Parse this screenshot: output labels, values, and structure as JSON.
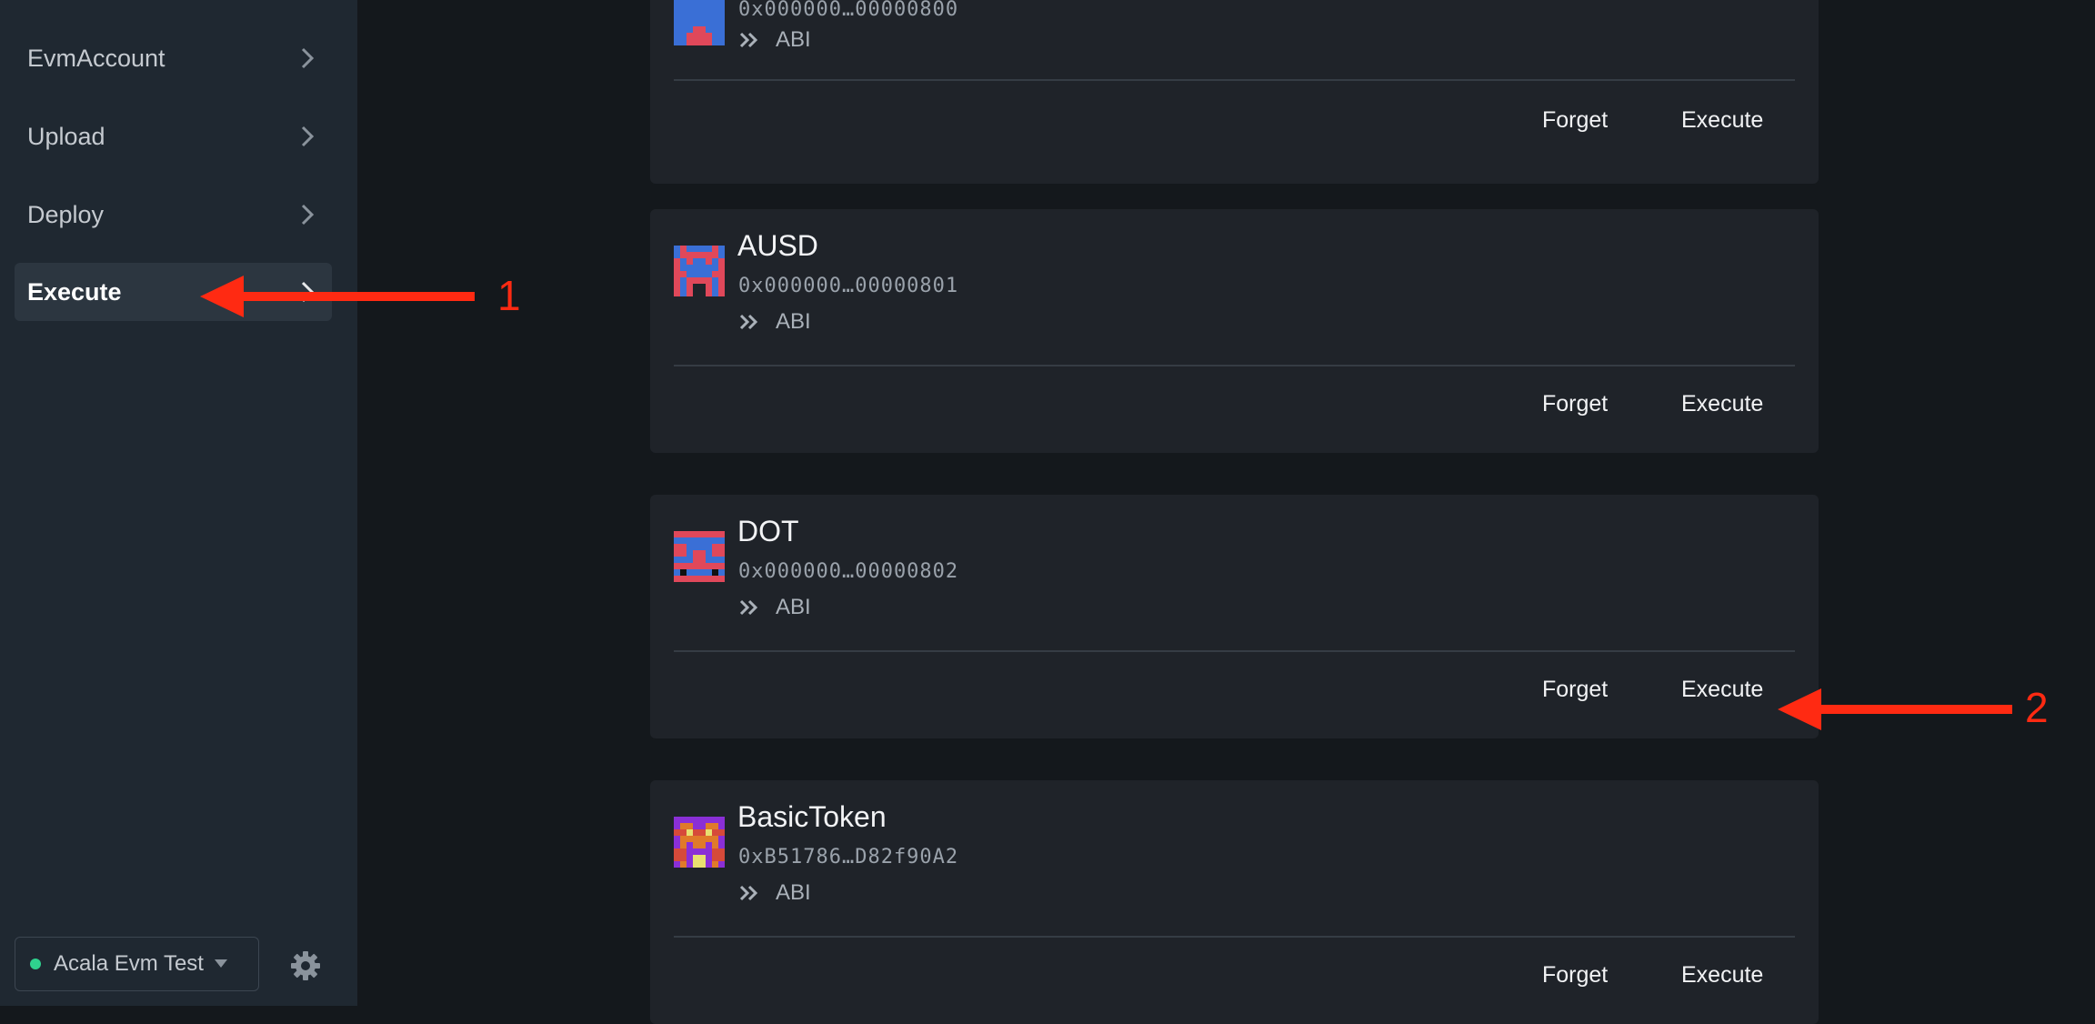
{
  "sidebar": {
    "items": [
      {
        "label": "EvmAccount",
        "active": false
      },
      {
        "label": "Upload",
        "active": false
      },
      {
        "label": "Deploy",
        "active": false
      },
      {
        "label": "Execute",
        "active": true
      }
    ],
    "network": {
      "name": "Acala Evm Test",
      "status_color": "#2fd28e"
    }
  },
  "contracts": [
    {
      "name": "",
      "address": "0x000000…00000800",
      "abi_label": "ABI",
      "forget_label": "Forget",
      "execute_label": "Execute",
      "identicon": "identicon-red-blue"
    },
    {
      "name": "AUSD",
      "address": "0x000000…00000801",
      "abi_label": "ABI",
      "forget_label": "Forget",
      "execute_label": "Execute",
      "identicon": "identicon-red-blue"
    },
    {
      "name": "DOT",
      "address": "0x000000…00000802",
      "abi_label": "ABI",
      "forget_label": "Forget",
      "execute_label": "Execute",
      "identicon": "identicon-blue-red"
    },
    {
      "name": "BasicToken",
      "address": "0xB51786…D82f90A2",
      "abi_label": "ABI",
      "forget_label": "Forget",
      "execute_label": "Execute",
      "identicon": "identicon-purple-orange"
    }
  ],
  "annotations": {
    "step1": "1",
    "step2": "2",
    "color": "#ff2a12"
  },
  "colors": {
    "sidebar_bg": "#1f2831",
    "page_bg": "#14181c",
    "card_bg": "#1f2329"
  }
}
